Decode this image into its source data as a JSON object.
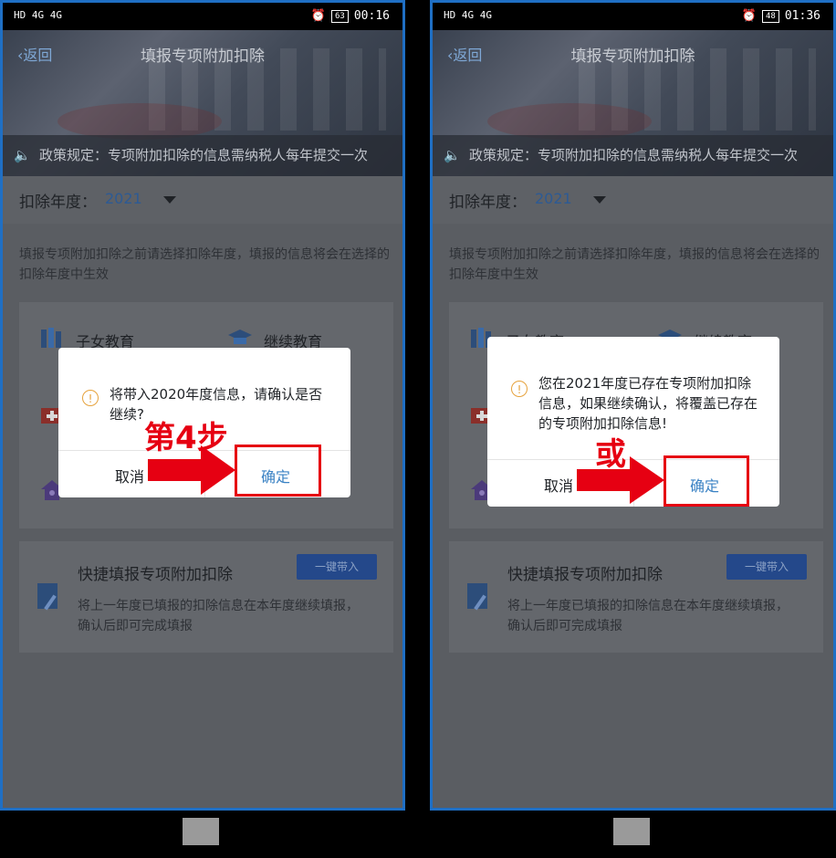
{
  "left": {
    "status": {
      "time": "00:16",
      "battery": "63",
      "signal_text": "HD 4G 4G"
    },
    "header": {
      "back_label": "返回",
      "title": "填报专项附加扣除"
    },
    "policy_text": "政策规定：专项附加扣除的信息需纳税人每年提交一次",
    "year_label": "扣除年度：",
    "year_value": "2021",
    "description": "填报专项附加扣除之前请选择扣除年度，填报的信息将会在选择的扣除年度中生效",
    "grid": [
      "子女教育",
      "继续教育"
    ],
    "quick": {
      "title": "快捷填报专项附加扣除",
      "button": "一键带入",
      "desc": "将上一年度已填报的扣除信息在本年度继续填报，确认后即可完成填报"
    },
    "dialog": {
      "message": "将带入2020年度信息，请确认是否继续?",
      "cancel": "取消",
      "confirm": "确定"
    },
    "annotation": "第4步"
  },
  "right": {
    "status": {
      "time": "01:36",
      "battery": "48",
      "signal_text": "HD 4G 4G"
    },
    "header": {
      "back_label": "返回",
      "title": "填报专项附加扣除"
    },
    "policy_text": "政策规定：专项附加扣除的信息需纳税人每年提交一次",
    "year_label": "扣除年度：",
    "year_value": "2021",
    "description": "填报专项附加扣除之前请选择扣除年度，填报的信息将会在选择的扣除年度中生效",
    "grid": [
      "子女教育",
      "继续教育"
    ],
    "quick": {
      "title": "快捷填报专项附加扣除",
      "button": "一键带入",
      "desc": "将上一年度已填报的扣除信息在本年度继续填报，确认后即可完成填报"
    },
    "dialog": {
      "message": "您在2021年度已存在专项附加扣除信息，如果继续确认，将覆盖已存在的专项附加扣除信息!",
      "cancel": "取消",
      "confirm": "确定"
    },
    "annotation": "或"
  },
  "colors": {
    "annotation_red": "#e60012",
    "accent_blue": "#3a82c4",
    "frame_blue": "#1f6fc4",
    "warning": "#e6a23c"
  }
}
